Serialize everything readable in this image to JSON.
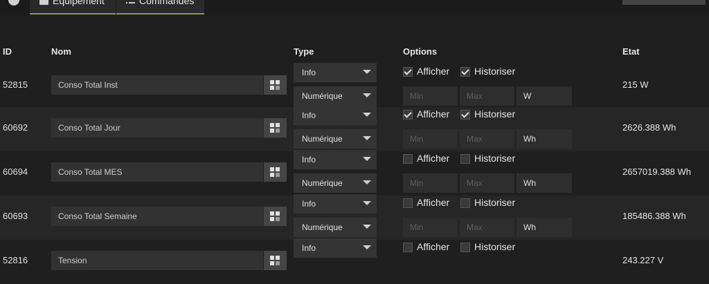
{
  "tabs": [
    {
      "label": "Equipement",
      "icon": "equipment-icon"
    },
    {
      "label": "Commandes",
      "icon": "list-icon"
    }
  ],
  "columns": {
    "id": "ID",
    "name": "Nom",
    "type": "Type",
    "options": "Options",
    "state": "Etat"
  },
  "rows": [
    {
      "id": "52815",
      "name": "Conso Total Inst",
      "type1": "Info",
      "type2": "Numérique",
      "afficher": true,
      "historiser": true,
      "min": "",
      "max": "",
      "unit": "W",
      "state": "215 W"
    },
    {
      "id": "60692",
      "name": "Conso Total Jour",
      "type1": "Info",
      "type2": "Numérique",
      "afficher": true,
      "historiser": true,
      "min": "",
      "max": "",
      "unit": "Wh",
      "state": "2626.388 Wh"
    },
    {
      "id": "60694",
      "name": "Conso Total MES",
      "type1": "Info",
      "type2": "Numérique",
      "afficher": false,
      "historiser": false,
      "min": "",
      "max": "",
      "unit": "Wh",
      "state": "2657019.388 Wh"
    },
    {
      "id": "60693",
      "name": "Conso Total Semaine",
      "type1": "Info",
      "type2": "Numérique",
      "afficher": false,
      "historiser": false,
      "min": "",
      "max": "",
      "unit": "Wh",
      "state": "185486.388 Wh"
    },
    {
      "id": "52816",
      "name": "Tension",
      "type1": "Info",
      "type2": "",
      "afficher": false,
      "historiser": false,
      "min": "",
      "max": "",
      "unit": "",
      "state": "243.227 V"
    }
  ],
  "labels": {
    "afficher": "Afficher",
    "historiser": "Historiser",
    "min_placeholder": "Min",
    "max_placeholder": "Max"
  }
}
